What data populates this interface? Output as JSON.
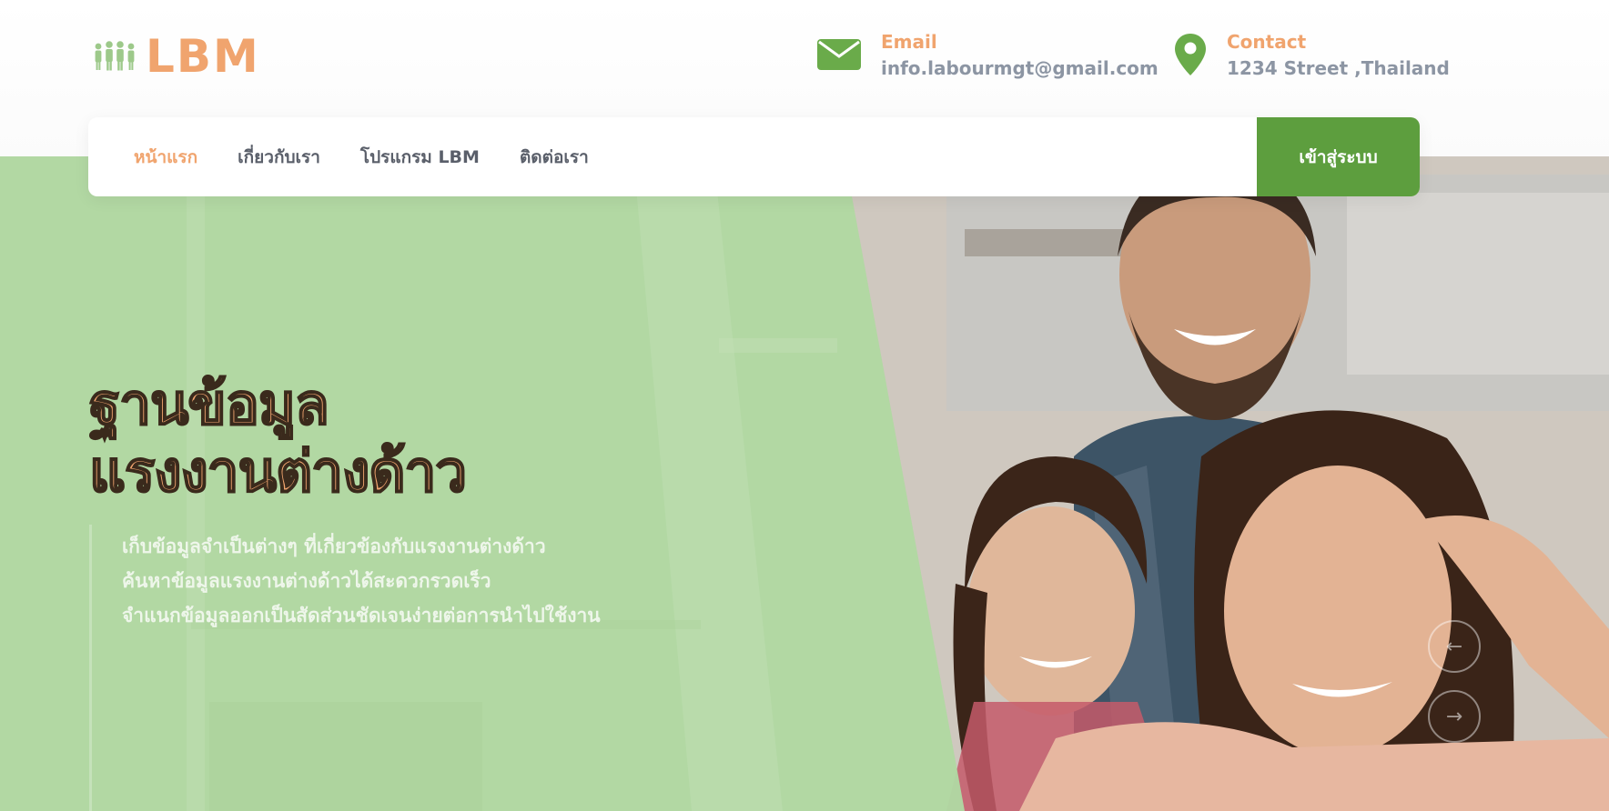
{
  "brand": {
    "name": "LBM",
    "icon": "people-group-icon",
    "color": "#f0a46e"
  },
  "header": {
    "email": {
      "icon": "envelope-icon",
      "label": "Email",
      "value": "info.labourmgt@gmail.com"
    },
    "contact": {
      "icon": "map-pin-icon",
      "label": "Contact",
      "value": "1234 Street ,Thailand"
    }
  },
  "nav": {
    "items": [
      {
        "label": "หน้าแรก",
        "active": true
      },
      {
        "label": "เกี่ยวกับเรา",
        "active": false
      },
      {
        "label": "โปรแกรม LBM",
        "active": false
      },
      {
        "label": "ติดต่อเรา",
        "active": false
      }
    ],
    "login_label": "เข้าสู่ระบบ"
  },
  "hero": {
    "title_line1": "ฐานข้อมูล",
    "title_line2": "แรงงานต่างด้าว",
    "description": [
      "เก็บข้อมูลจำเป็นต่างๆ ที่เกี่ยวข้องกับแรงงานต่างด้าว",
      "ค้นหาข้อมูลแรงงานต่างด้าวได้สะดวกรวดเร็ว",
      "จำแนกข้อมูลออกเป็นสัดส่วนชัดเจนง่ายต่อการนำไปใช้งาน"
    ],
    "prev_icon": "arrow-left-icon",
    "next_icon": "arrow-right-icon"
  },
  "colors": {
    "accent_orange": "#f0a46e",
    "accent_green": "#5d9e3e",
    "hero_green": "#b1d8a2",
    "text_gray": "#8c95a3"
  }
}
